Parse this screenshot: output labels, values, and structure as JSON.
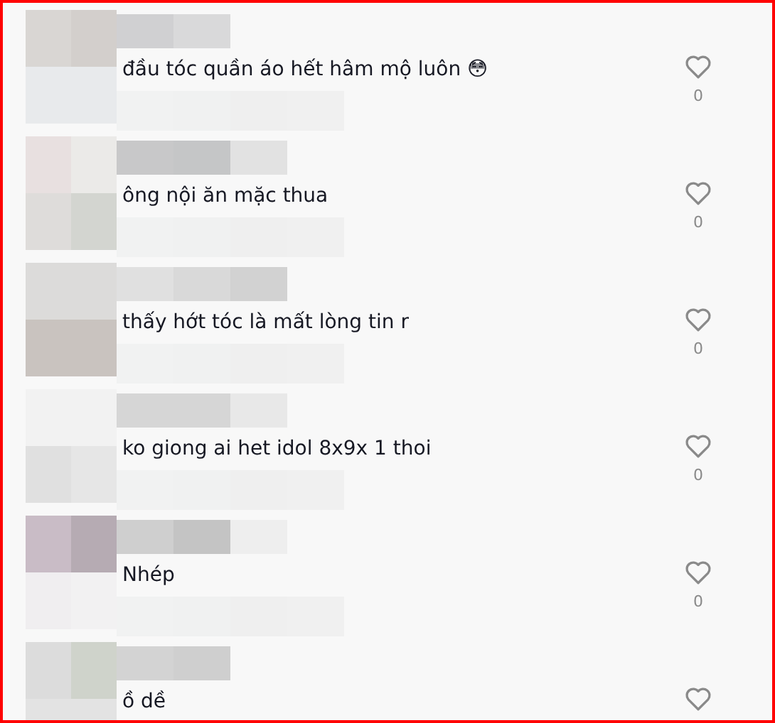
{
  "comments": [
    {
      "text": "đầu tóc quần áo hết hâm mộ luôn 😳",
      "likes": "0"
    },
    {
      "text": "ông nội ăn mặc thua",
      "likes": "0"
    },
    {
      "text": "thấy hớt tóc là mất lòng tin r",
      "likes": "0"
    },
    {
      "text": "ko giong ai het idol 8x9x 1 thoi",
      "likes": "0"
    },
    {
      "text": "Nhép",
      "likes": "0"
    },
    {
      "text": "ồ dề"
    }
  ]
}
